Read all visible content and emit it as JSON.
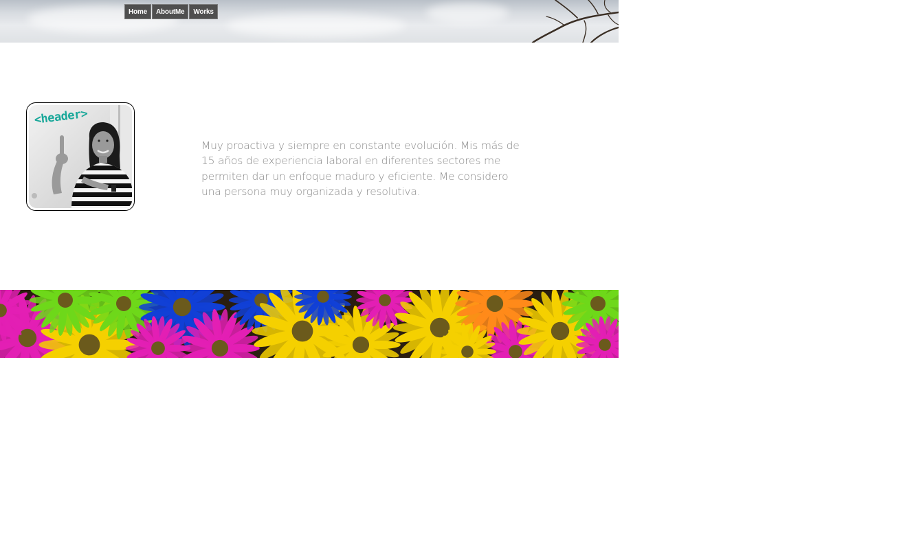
{
  "nav": {
    "items": [
      {
        "label": "Home"
      },
      {
        "label": "AboutMe"
      },
      {
        "label": "Works"
      }
    ]
  },
  "profile": {
    "tag_text": "<header>"
  },
  "about": {
    "text": "Muy proactiva y siempre en constante evolución. Mis más de 15 años de experiencia laboral en diferentes sectores me permiten dar un enfoque maduro y eficiente. Me considero una persona muy organizada y resolutiva."
  },
  "colors": {
    "nav_bg": "#4f4f4f",
    "text": "#8a8a8a",
    "tag": "#1aa89a",
    "flowers": [
      "#f5d000",
      "#e31fb4",
      "#1140d6",
      "#6ed81a",
      "#ff8a1a"
    ]
  }
}
